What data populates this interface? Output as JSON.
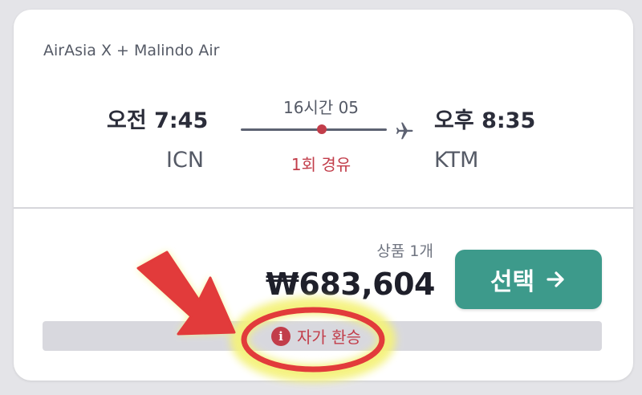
{
  "flight": {
    "airline": "AirAsia X + Malindo Air",
    "departure_time": "오전 7:45",
    "arrival_time": "오후 8:35",
    "departure_airport": "ICN",
    "arrival_airport": "KTM",
    "duration": "16시간 05",
    "stops": "1회 경유"
  },
  "offer": {
    "deal_count": "상품 1개",
    "price": "₩683,604",
    "select_label": "선택",
    "notice": "자가 환승",
    "notice_icon": "info-icon"
  },
  "colors": {
    "accent_teal": "#3d9a8b",
    "warning_red": "#c23d4a",
    "annotation_red": "#e23b3b",
    "highlight_yellow": "#f4f27a"
  }
}
